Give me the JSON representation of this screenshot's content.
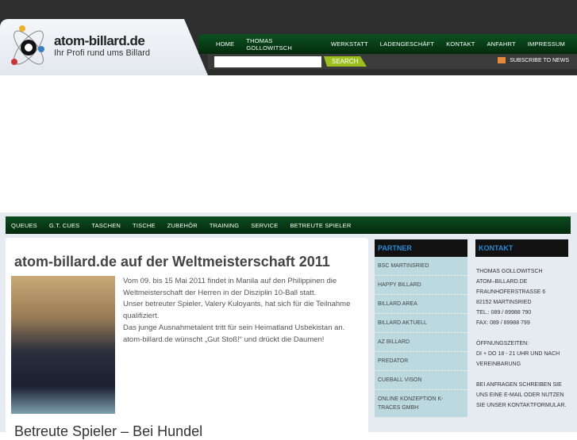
{
  "logo": {
    "title": "atom-billard.de",
    "subtitle": "Ihr Profi rund ums Billard"
  },
  "main_nav": [
    "HOME",
    "THOMAS GOLLOWITSCH",
    "WERKSTATT",
    "LADENGESCHÄFT",
    "KONTAKT",
    "ANFAHRT",
    "IMPRESSUM"
  ],
  "search": {
    "value": "",
    "button": "SEARCH"
  },
  "subscribe": "SUBSCRIBE TO NEWS",
  "category_nav": [
    "QUEUES",
    "G.T. CUES",
    "TASCHEN",
    "TISCHE",
    "ZUBEHÖR",
    "TRAINING",
    "SERVICE",
    "BETREUTE SPIELER"
  ],
  "article": {
    "title": "atom-billard.de auf der Weltmeisterschaft 2011",
    "lines": [
      "Vom 09. bis 15 Mai 2011 findet in Manila auf den Philippinen die Weltmeisterschaft der Herren in der Disziplin 10-Ball statt.",
      "Unser betreuter Spieler, Valery Kuloyants, hat sich für die Teilnahme qualifiziert.",
      "Das junge Ausnahmetalent tritt für sein Heimatland Usbekistan an.",
      "atom-billard.de wünscht „Gut Stoß!“ und drückt die Daumen!"
    ]
  },
  "next_heading": "Betreute Spieler – Bei Hundel",
  "partner": {
    "title": "PARTNER",
    "items": [
      "BSC MARTINSRIED",
      "HAPPY BILLARD",
      "BILLARD AREA",
      "BILLARD AKTUELL",
      "AZ BILLARD",
      "PREDATOR",
      "CUEBALL VISON",
      "ONLINE KONZEPTION K-TRACES GMBH"
    ]
  },
  "kontakt": {
    "title": "KONTAKT",
    "address": "THOMAS GOLLOWITSCH\nATOM–BILLARD.DE\nFRAUNHOFERSTRASSE 6\n82152 MARTINSRIED\nTEL.: 089 / 89988 790\nFAX: 089 / 89988 799",
    "hours": "ÖFFNUNGSZEITEN:\nDI + DO 18 - 21 UHR UND NACH VEREINBARUNG",
    "note": "BEI ANFRAGEN SCHREIBEN SIE UNS EINE E-MAIL ODER NUTZEN SIE UNSER KONTAKTFORMULAR."
  }
}
